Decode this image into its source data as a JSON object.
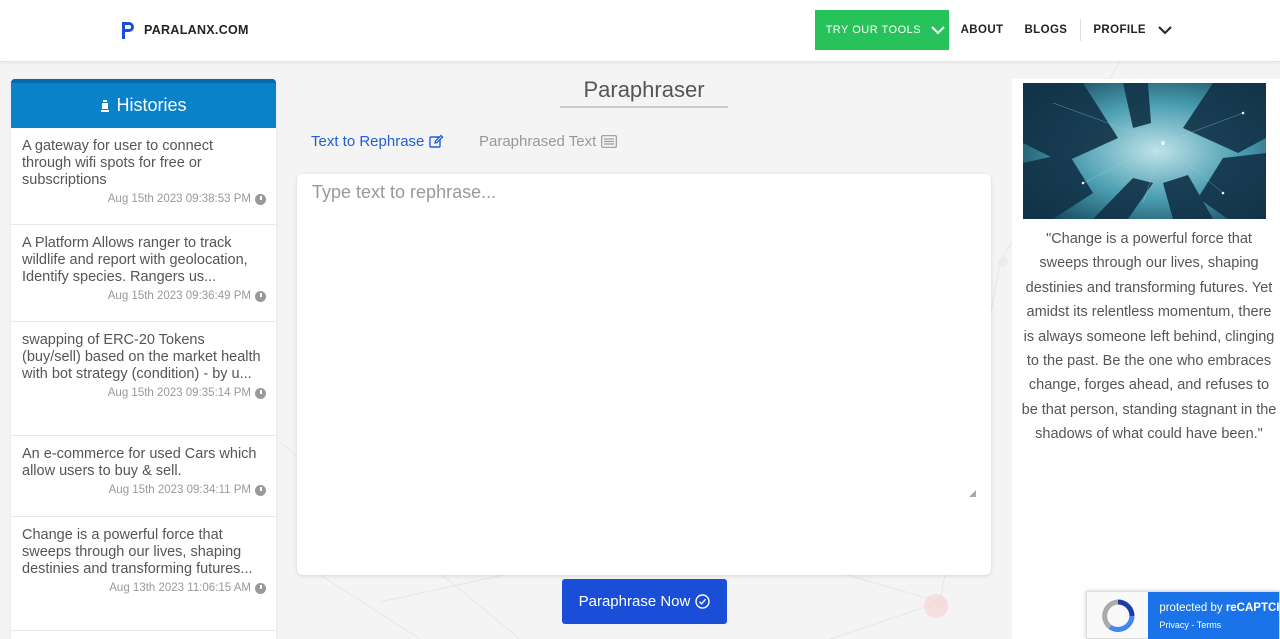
{
  "header": {
    "brand": "PARALANX.COM",
    "nav": {
      "tools": "TRY OUR TOOLS",
      "about": "ABOUT",
      "blogs": "BLOGS",
      "profile": "PROFILE"
    }
  },
  "sidebar": {
    "title": "Histories",
    "items": [
      {
        "text": "A gateway for user to connect through wifi spots for free or subscriptions",
        "time": "Aug 15th 2023 09:38:53 PM"
      },
      {
        "text": "A Platform Allows ranger to track wildlife and report with geolocation, Identify species. Rangers us...",
        "time": "Aug 15th 2023 09:36:49 PM"
      },
      {
        "text": "swapping of ERC-20 Tokens (buy/sell) based on the market health with bot strategy (condition) - by u...",
        "time": "Aug 15th 2023 09:35:14 PM"
      },
      {
        "text": "An e-commerce for used Cars which allow users to buy & sell.",
        "time": "Aug 15th 2023 09:34:11 PM"
      },
      {
        "text": "Change is a powerful force that sweeps through our lives, shaping destinies and transforming futures...",
        "time": "Aug 13th 2023 11:06:15 AM"
      }
    ]
  },
  "main": {
    "title": "Paraphraser",
    "tabs": {
      "rephrase": "Text to Rephrase",
      "paraphrased": "Paraphrased Text"
    },
    "input_placeholder": "Type text to rephrase...",
    "submit_label": "Paraphrase Now"
  },
  "quote": {
    "text": "\"Change is a powerful force that sweeps through our lives, shaping destinies and transforming futures. Yet amidst its relentless momentum, there is always someone left behind, clinging to the past. Be the one who embraces change, forges ahead, and refuses to be that person, standing stagnant in the shadows of what could have been.\""
  },
  "recaptcha": {
    "protected_prefix": "protected by ",
    "brand": "reCAPTCHA",
    "privacy": "Privacy",
    "separator": " - ",
    "terms": "Terms"
  },
  "colors": {
    "accent_blue": "#1a4ed8",
    "sidebar_header": "#0a82c9",
    "tools_green": "#28c25a",
    "tab_active": "#1e5fd6"
  }
}
